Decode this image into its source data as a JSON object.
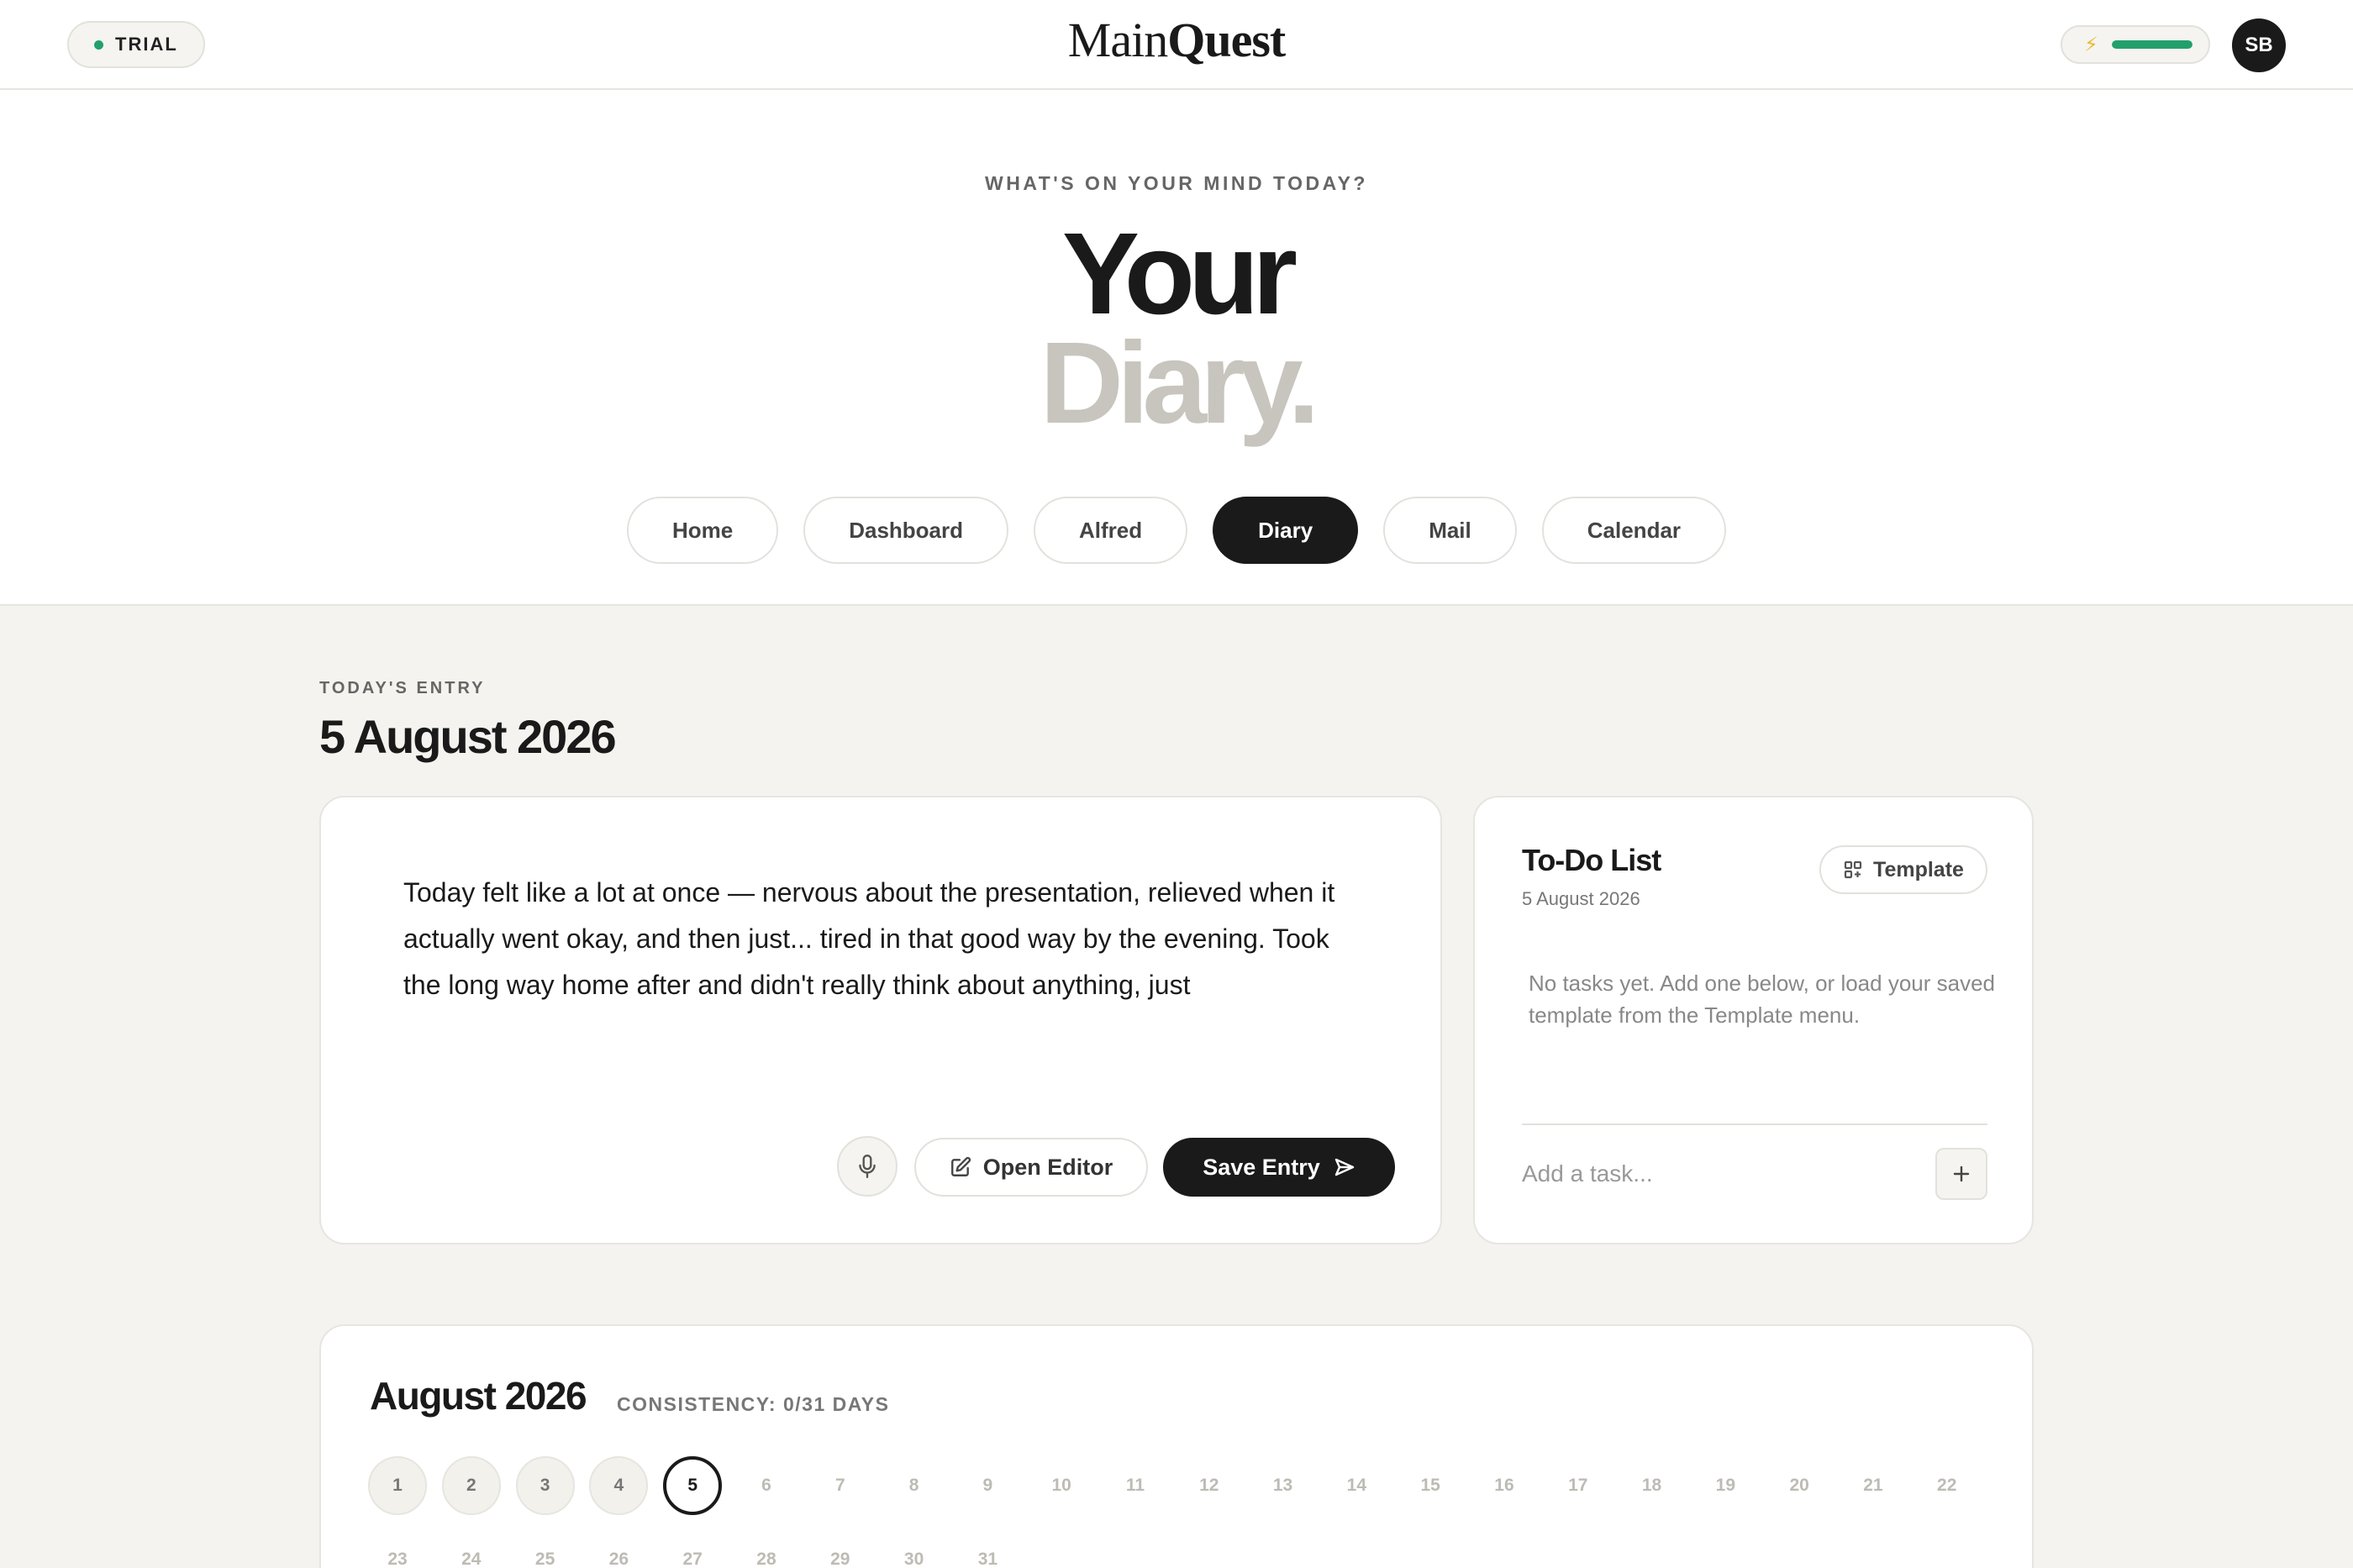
{
  "header": {
    "trial_label": "TRIAL",
    "logo_main": "Main",
    "logo_quest": "Quest",
    "energy_level": 1.0,
    "avatar_initials": "SB",
    "colors": {
      "accent": "#22a06b",
      "energy_icon": "#e8b931"
    }
  },
  "hero": {
    "kicker": "WHAT'S ON YOUR MIND TODAY?",
    "title_line1": "Your",
    "title_line2": "Diary."
  },
  "nav": {
    "items": [
      {
        "label": "Home"
      },
      {
        "label": "Dashboard"
      },
      {
        "label": "Alfred"
      },
      {
        "label": "Diary"
      },
      {
        "label": "Mail"
      },
      {
        "label": "Calendar"
      }
    ],
    "active": "Diary"
  },
  "entry": {
    "kicker": "TODAY'S ENTRY",
    "date": "5 August 2026",
    "text": "Today felt like a lot at once — nervous about the presentation, relieved when it actually went okay, and then just... tired in that good way by the evening. Took the long way home after and didn't really think about anything, just",
    "mic_icon": "microphone-icon",
    "open_editor_label": "Open Editor",
    "save_label": "Save Entry"
  },
  "todo": {
    "title": "To-Do List",
    "date": "5 August 2026",
    "template_label": "Template",
    "empty_message": "No tasks yet. Add one below, or load your saved template from the Template menu.",
    "add_placeholder": "Add a task...",
    "add_icon": "plus-icon"
  },
  "calendar": {
    "month": "August 2026",
    "consistency": "CONSISTENCY: 0/31 DAYS",
    "today": 5,
    "days": [
      "1",
      "2",
      "3",
      "4",
      "5",
      "6",
      "7",
      "8",
      "9",
      "10",
      "11",
      "12",
      "13",
      "14",
      "15",
      "16",
      "17",
      "18",
      "19",
      "20",
      "21",
      "22",
      "23",
      "24",
      "25",
      "26",
      "27",
      "28",
      "29",
      "30",
      "31"
    ]
  }
}
